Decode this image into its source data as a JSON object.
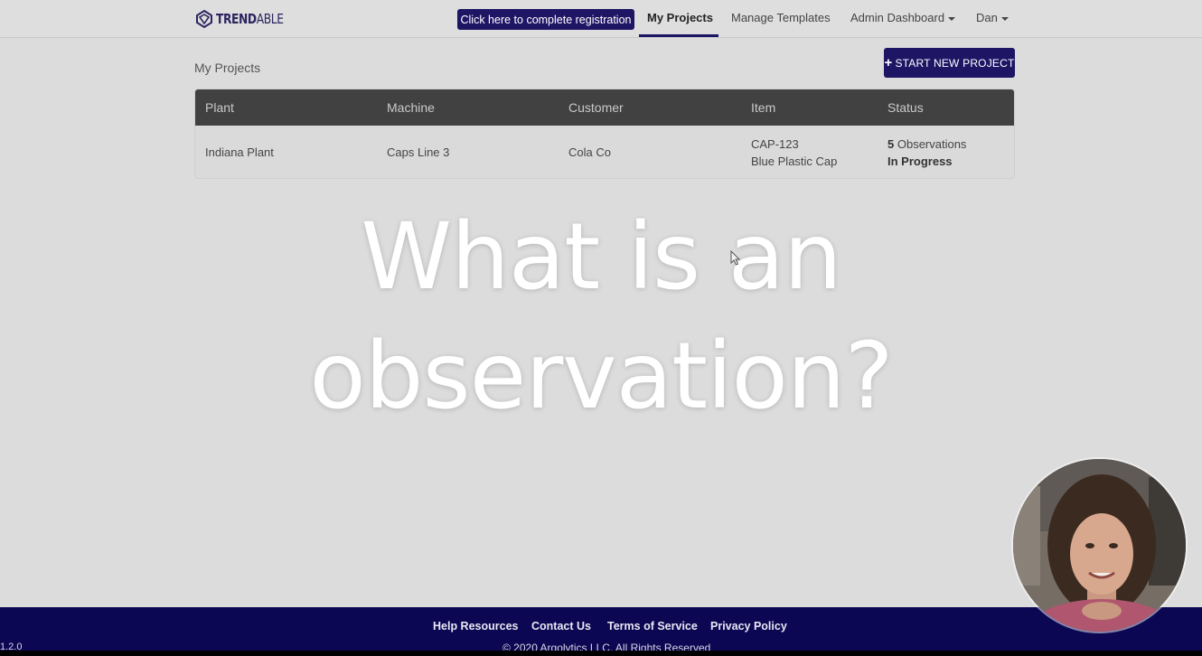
{
  "brand": {
    "logo_text_bold": "TREND",
    "logo_text_thin": "ABLE"
  },
  "nav": {
    "registration_button": "Click here to complete registration",
    "my_projects": "My Projects",
    "manage_templates": "Manage Templates",
    "admin_dashboard": "Admin Dashboard",
    "user": "Dan"
  },
  "page": {
    "title": "My Projects",
    "start_button": "START NEW PROJECT"
  },
  "table": {
    "headers": [
      "Plant",
      "Machine",
      "Customer",
      "Item",
      "Status"
    ],
    "rows": [
      {
        "plant": "Indiana Plant",
        "machine": "Caps Line 3",
        "customer": "Cola Co",
        "item_code": "CAP-123",
        "item_name": "Blue Plastic Cap",
        "observations_count": "5",
        "observations_label": " Observations",
        "status": "In Progress"
      }
    ]
  },
  "overlay": {
    "line1": "What is an",
    "line2": "observation?"
  },
  "footer": {
    "links": [
      "Help Resources",
      "Contact Us",
      "Terms of Service",
      "Privacy Policy"
    ],
    "copyright": "© 2020 Argolytics LLC. All Rights Reserved",
    "version": "1.2.0"
  },
  "colors": {
    "brand_navy": "#1f1565",
    "footer_navy": "#0c0752",
    "table_header": "#414141",
    "background": "#dcdcdc"
  },
  "icons": [
    "trendable-logo-icon",
    "plus-icon",
    "caret-down-icon",
    "mouse-cursor-icon"
  ]
}
